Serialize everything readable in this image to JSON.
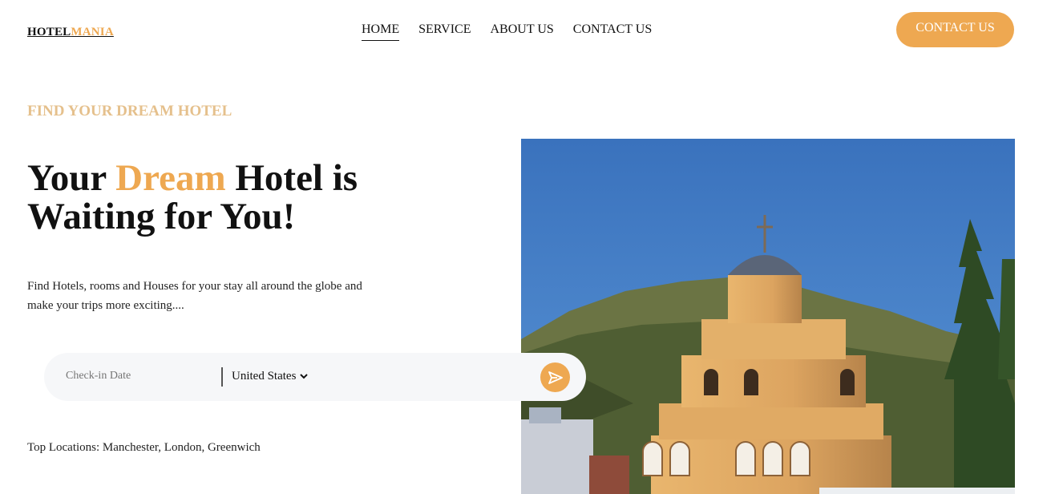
{
  "logo": {
    "part1": "HOTEL",
    "part2": "MANIA"
  },
  "nav": {
    "items": [
      {
        "label": "HOME"
      },
      {
        "label": "SERVICE"
      },
      {
        "label": "ABOUT US"
      },
      {
        "label": "CONTACT US"
      }
    ]
  },
  "header": {
    "cta_label": "CONTACT US"
  },
  "hero": {
    "eyebrow": "FIND YOUR DREAM HOTEL",
    "headline_pre": "Your ",
    "headline_highlight": "Dream",
    "headline_post": " Hotel is",
    "headline_line2": "Waiting for You!",
    "description": "Find Hotels, rooms and Houses for your stay all around the globe and make your trips more exciting...."
  },
  "search": {
    "checkin_placeholder": "Check-in Date",
    "country_value": "United States",
    "country_icon": "chevron-down-icon",
    "submit_icon": "send-icon"
  },
  "top_locations": {
    "text": "Top Locations: Manchester, London, Greenwich"
  },
  "colors": {
    "accent": "#eea851",
    "eyebrow": "#e5c08c",
    "sky": "#3d77bf"
  }
}
